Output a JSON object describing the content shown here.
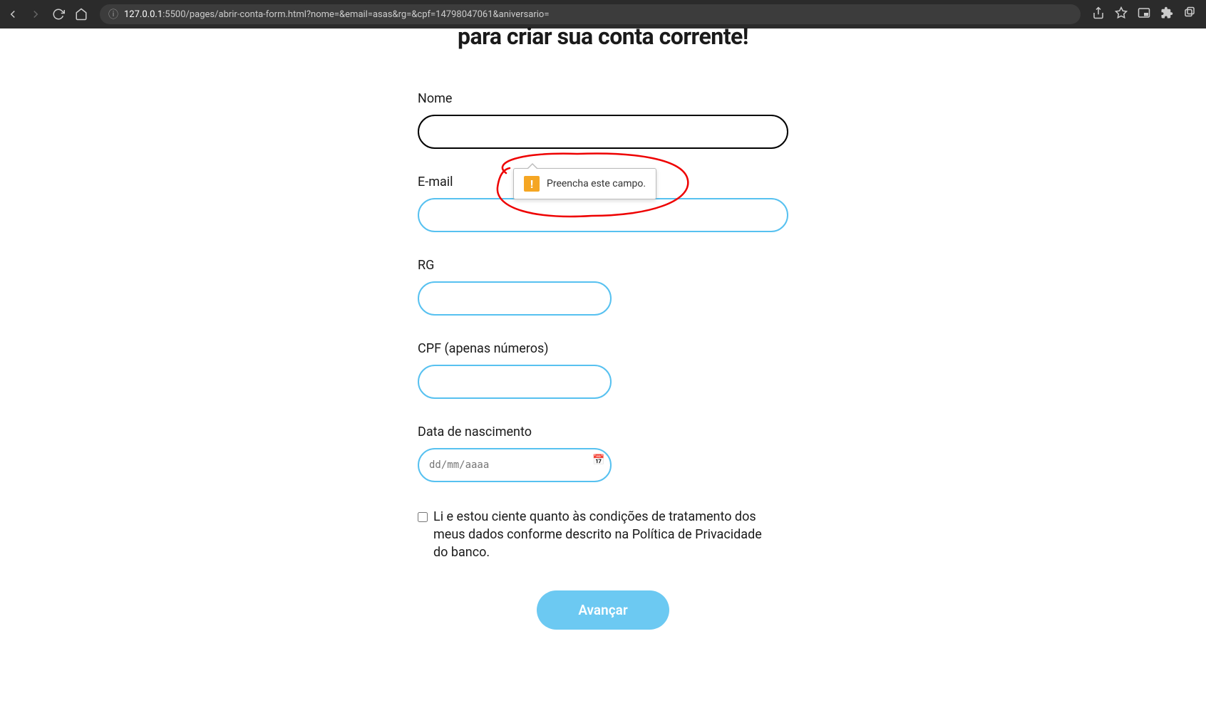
{
  "browser": {
    "url_host": "127.0.0.1",
    "url_rest": ":5500/pages/abrir-conta-form.html?nome=&email=asas&rg=&cpf=14798047061&aniversario="
  },
  "page": {
    "title": "para criar sua conta corrente!"
  },
  "form": {
    "nome": {
      "label": "Nome",
      "value": ""
    },
    "email": {
      "label": "E-mail",
      "value": ""
    },
    "rg": {
      "label": "RG",
      "value": ""
    },
    "cpf": {
      "label": "CPF (apenas números)",
      "value": ""
    },
    "aniversario": {
      "label": "Data de nascimento",
      "placeholder": "dd/mm/aaaa",
      "value": ""
    },
    "consent": {
      "label": "Li e estou ciente quanto às condições de tratamento dos meus dados conforme descrito na Política de Privacidade do banco."
    },
    "submit": {
      "label": "Avançar"
    }
  },
  "validation": {
    "message": "Preencha este campo."
  }
}
